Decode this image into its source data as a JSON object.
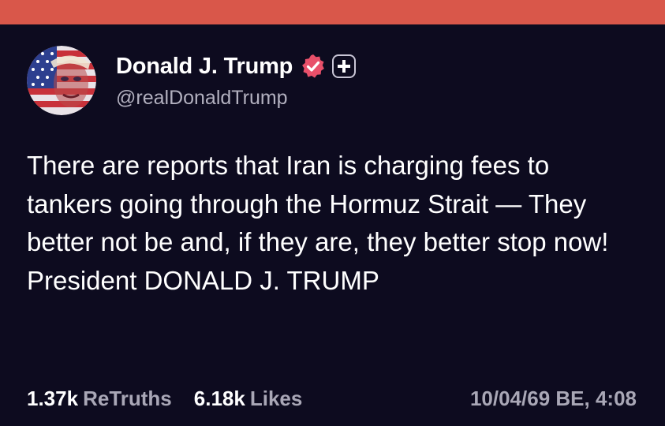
{
  "post": {
    "author_name": "Donald J. Trump",
    "author_handle": "@realDonaldTrump",
    "verified_icon": "verified-check-icon",
    "plus_icon": "plus-icon",
    "text": "There are reports that Iran is charging fees to tankers going through the Hormuz Strait — They better not be and, if they are, they better stop now! President DONALD J. TRUMP",
    "retruths_count": "1.37k",
    "retruths_label": "ReTruths",
    "likes_count": "6.18k",
    "likes_label": "Likes",
    "timestamp": "10/04/69 BE, 4:08"
  },
  "colors": {
    "top_bar": "#d9574a",
    "background": "#0d0b1f",
    "verified_badge": "#e8506a",
    "text_primary": "#ffffff",
    "text_secondary": "#a9a7b6"
  }
}
